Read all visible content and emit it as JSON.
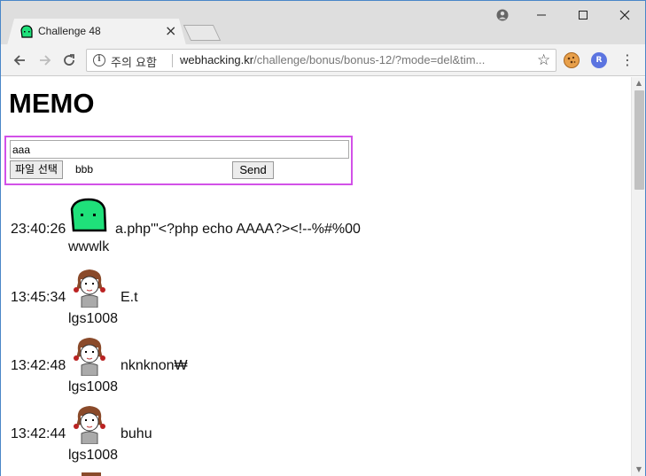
{
  "browser": {
    "tab_title": "Challenge 48",
    "security_label": "주의 요함",
    "url_host": "webhacking.kr",
    "url_path": "/challenge/bonus/bonus-12/?mode=del&tim...",
    "extension_badge": "R"
  },
  "page": {
    "title": "MEMO",
    "form": {
      "memo_value": "aaa",
      "file_button_label": "파일 선택",
      "file_name": "bbb",
      "send_label": "Send"
    },
    "entries": [
      {
        "time": "23:40:26",
        "message": "a.php'\"<?php echo AAAA?><!--%#%00",
        "user": "wwwlk",
        "avatar": "green-blob"
      },
      {
        "time": "13:45:34",
        "message": "E.t",
        "user": "lgs1008",
        "avatar": "girl"
      },
      {
        "time": "13:42:48",
        "message": "nknknon₩",
        "user": "lgs1008",
        "avatar": "girl"
      },
      {
        "time": "13:42:44",
        "message": "buhu",
        "user": "lgs1008",
        "avatar": "girl"
      }
    ]
  },
  "colors": {
    "form_border": "#d251e8",
    "green_blob": "#1fe07a",
    "tab_accent": "#4a86c8"
  },
  "icons": {
    "back": "arrow-left-icon",
    "forward": "arrow-right-icon",
    "reload": "reload-icon",
    "info": "info-icon",
    "bookmark": "star-icon",
    "menu": "kebab-menu-icon"
  }
}
